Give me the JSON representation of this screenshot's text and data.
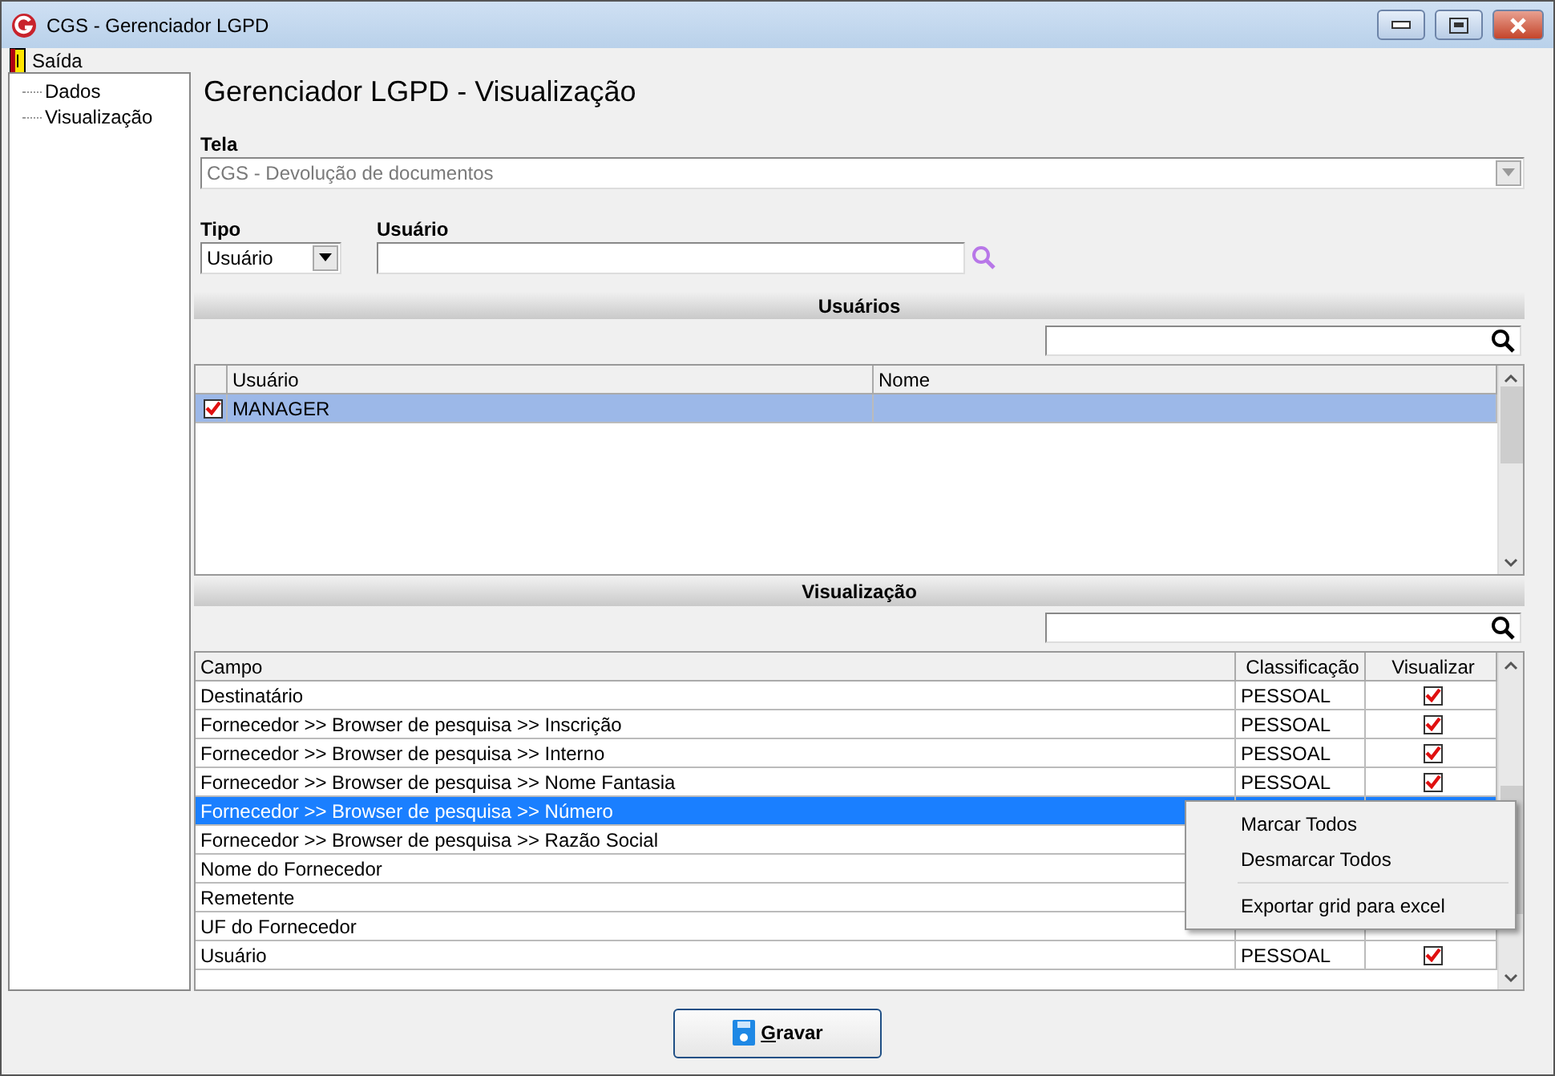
{
  "window": {
    "title": "CGS - Gerenciador LGPD"
  },
  "menu": [
    {
      "label": "Saída"
    }
  ],
  "sidebar": {
    "items": [
      {
        "label": "Dados"
      },
      {
        "label": "Visualização"
      }
    ]
  },
  "heading": "Gerenciador LGPD - Visualização",
  "tela": {
    "label": "Tela",
    "value": "CGS - Devolução de documentos",
    "disabled": true
  },
  "tipo": {
    "label": "Tipo",
    "value": "Usuário"
  },
  "usuario": {
    "label": "Usuário"
  },
  "users_section": {
    "title": "Usuários",
    "columns": [
      "Usuário",
      "Nome"
    ],
    "rows": [
      {
        "usuario": "MANAGER",
        "checked": true,
        "selected": true
      }
    ]
  },
  "visualization_section": {
    "title": "Visualização",
    "columns": [
      "Campo",
      "Classificação",
      "Visualizar"
    ],
    "rows": [
      {
        "campo": "Destinatário",
        "classificacao": "PESSOAL",
        "visualizar": true,
        "selected": false
      },
      {
        "campo": "Fornecedor >> Browser de pesquisa >> Inscrição",
        "classificacao": "PESSOAL",
        "visualizar": true,
        "selected": false
      },
      {
        "campo": "Fornecedor >> Browser de pesquisa >> Interno",
        "classificacao": "PESSOAL",
        "visualizar": true,
        "selected": false
      },
      {
        "campo": "Fornecedor >> Browser de pesquisa >> Nome Fantasia",
        "classificacao": "PESSOAL",
        "visualizar": true,
        "selected": false
      },
      {
        "campo": "Fornecedor >> Browser de pesquisa >> Número",
        "selected": true
      },
      {
        "campo": "Fornecedor >> Browser de pesquisa >> Razão Social",
        "selected": false
      },
      {
        "campo": "Nome do Fornecedor",
        "selected": false
      },
      {
        "campo": "Remetente",
        "selected": false
      },
      {
        "campo": "UF do Fornecedor",
        "selected": false
      },
      {
        "campo": "Usuário",
        "classificacao": "PESSOAL",
        "visualizar": true,
        "selected": false
      }
    ]
  },
  "context_menu": {
    "items": [
      {
        "label": "Marcar Todos",
        "separator_before": false
      },
      {
        "label": "Desmarcar Todos",
        "separator_before": false
      },
      {
        "label": "Exportar grid para excel",
        "separator_before": true
      }
    ]
  },
  "buttons": [
    {
      "label": "Gravar"
    }
  ]
}
